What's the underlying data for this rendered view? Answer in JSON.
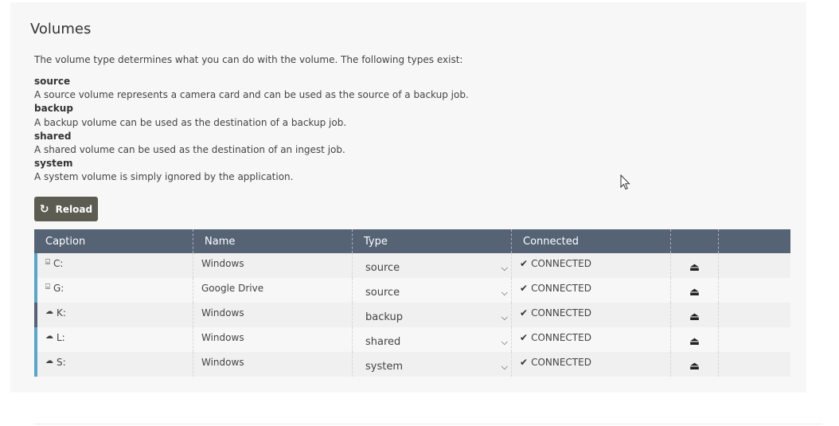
{
  "panel": {
    "title": "Volumes",
    "intro": "The volume type determines what you can do with the volume. The following types exist:"
  },
  "types": [
    {
      "term": "source",
      "desc": "A source volume represents a camera card and can be used as the source of a backup job."
    },
    {
      "term": "backup",
      "desc": "A backup volume can be used as the destination of a backup job."
    },
    {
      "term": "shared",
      "desc": "A shared volume can be used as the destination of an ingest job."
    },
    {
      "term": "system",
      "desc": "A system volume is simply ignored by the application."
    }
  ],
  "reload_button": {
    "label": "Reload",
    "icon": "refresh-icon"
  },
  "table": {
    "headers": [
      "Caption",
      "Name",
      "Type",
      "Connected",
      "",
      ""
    ],
    "rows": [
      {
        "icon": "drive-icon",
        "caption": "C:",
        "name": "Windows",
        "type": "source",
        "connected": "CONNECTED",
        "accent": "#5ca4c8"
      },
      {
        "icon": "drive-icon",
        "caption": "G:",
        "name": "Google Drive",
        "type": "source",
        "connected": "CONNECTED",
        "accent": "#5ca4c8"
      },
      {
        "icon": "cloud-icon",
        "caption": "K:",
        "name": "Windows",
        "type": "backup",
        "connected": "CONNECTED",
        "accent": "#566375"
      },
      {
        "icon": "cloud-icon",
        "caption": "L:",
        "name": "Windows",
        "type": "shared",
        "connected": "CONNECTED",
        "accent": "#5ca4c8"
      },
      {
        "icon": "cloud-icon",
        "caption": "S:",
        "name": "Windows",
        "type": "system",
        "connected": "CONNECTED",
        "accent": "#5ca4c8"
      }
    ]
  },
  "colors": {
    "header_bg": "#566375",
    "button_bg": "#5c5c52",
    "row_accent": "#5ca4c8"
  }
}
